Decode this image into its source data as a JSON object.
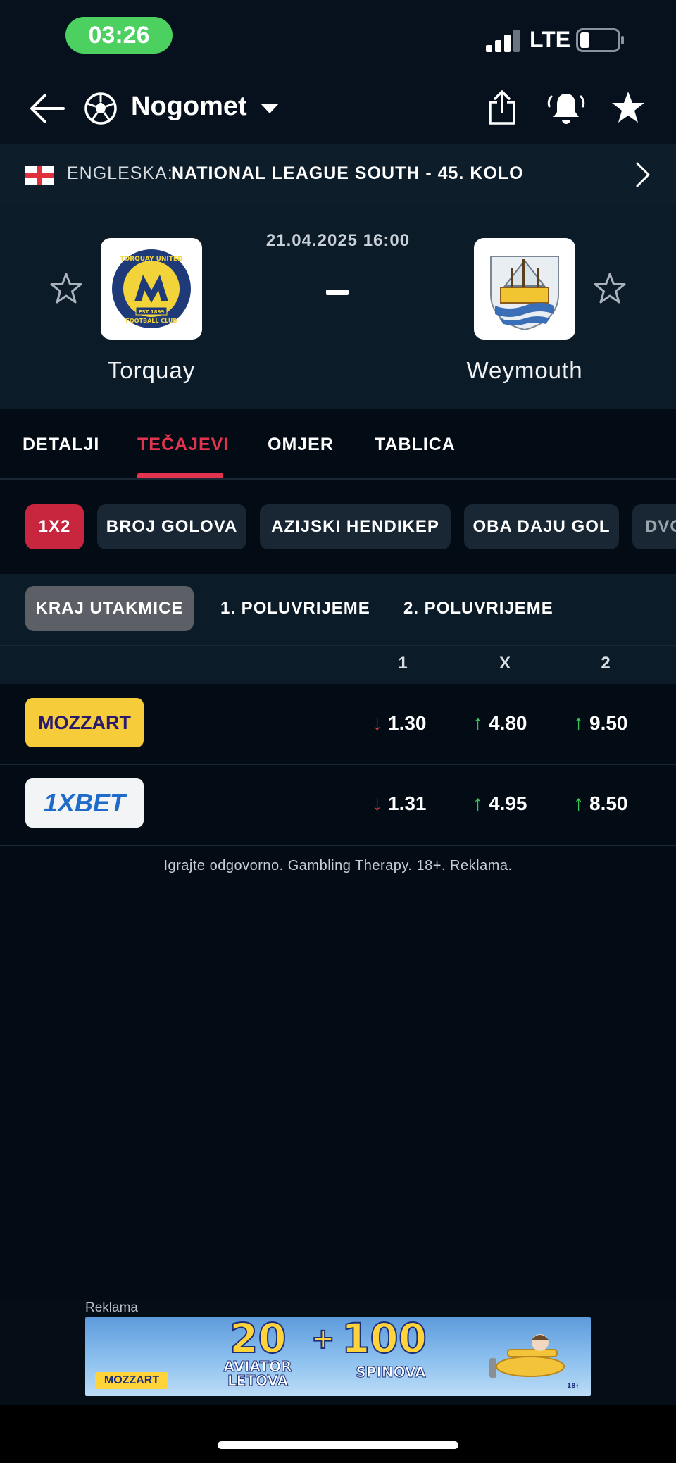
{
  "status_bar": {
    "time": "03:26",
    "network": "LTE"
  },
  "nav": {
    "sport": "Nogomet"
  },
  "league": {
    "country": "ENGLESKA:",
    "name": "NATIONAL LEAGUE SOUTH - 45. KOLO"
  },
  "match": {
    "datetime": "21.04.2025 16:00",
    "home_team": "Torquay",
    "away_team": "Weymouth",
    "home_crest_text": [
      "TORQUAY UNITED",
      "FOOTBALL CLUB",
      "EST 1899"
    ]
  },
  "tabs": [
    {
      "label": "DETALJI",
      "active": false
    },
    {
      "label": "TEČAJEVI",
      "active": true
    },
    {
      "label": "OMJER",
      "active": false
    },
    {
      "label": "TABLICA",
      "active": false
    }
  ],
  "markets": [
    {
      "label": "1X2",
      "active": true
    },
    {
      "label": "BROJ GOLOVA",
      "active": false
    },
    {
      "label": "AZIJSKI HENDIKEP",
      "active": false
    },
    {
      "label": "OBA DAJU GOL",
      "active": false
    },
    {
      "label": "DVO",
      "active": false
    }
  ],
  "periods": [
    {
      "label": "KRAJ UTAKMICE",
      "active": true
    },
    {
      "label": "1. POLUVRIJEME",
      "active": false
    },
    {
      "label": "2. POLUVRIJEME",
      "active": false
    }
  ],
  "odds_columns": [
    "1",
    "X",
    "2"
  ],
  "bookmakers": [
    {
      "name": "MOZZART",
      "odds": [
        {
          "value": "1.30",
          "trend": "down"
        },
        {
          "value": "4.80",
          "trend": "up"
        },
        {
          "value": "9.50",
          "trend": "up"
        }
      ]
    },
    {
      "name": "1XBET",
      "odds": [
        {
          "value": "1.31",
          "trend": "down"
        },
        {
          "value": "4.95",
          "trend": "up"
        },
        {
          "value": "8.50",
          "trend": "up"
        }
      ]
    }
  ],
  "disclaimer": "Igrajte odgovorno. Gambling Therapy. 18+. Reklama.",
  "ad": {
    "label": "Reklama",
    "big_left": "20",
    "small_left": "AVIATOR LETOVA",
    "plus": "+",
    "big_right": "100",
    "small_right": "SPINOVA",
    "brand": "MOZZART",
    "age": "18+"
  },
  "colors": {
    "accent": "#e3344f",
    "chip_active": "#c8253f",
    "odds_up": "#36c35a",
    "odds_down": "#d93a3a",
    "time_pill": "#4cd160"
  }
}
